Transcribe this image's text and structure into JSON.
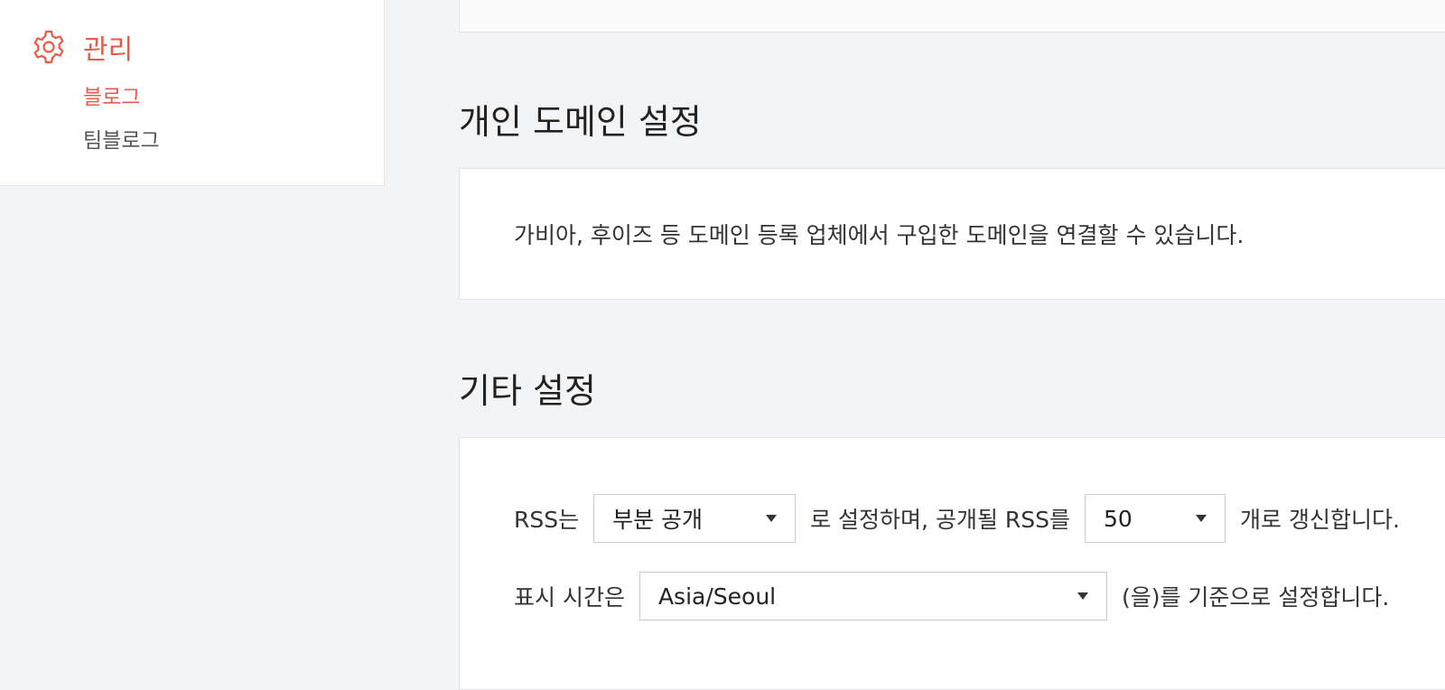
{
  "sidebar": {
    "title": "관리",
    "items": [
      {
        "label": "블로그",
        "active": true
      },
      {
        "label": "팀블로그",
        "active": false
      }
    ],
    "accent_color": "#eb5a46",
    "icon": "gear-icon"
  },
  "domain_section": {
    "title": "개인 도메인 설정",
    "description": "가비아, 후이즈 등 도메인 등록 업체에서 구입한 도메인을 연결할 수 있습니다."
  },
  "other_section": {
    "title": "기타 설정",
    "rss": {
      "prefix": "RSS는",
      "mode_value": "부분 공개",
      "middle": "로 설정하며, 공개될 RSS를",
      "count_value": "50",
      "suffix": "개로 갱신합니다."
    },
    "timezone": {
      "prefix": "표시 시간은",
      "value": "Asia/Seoul",
      "suffix": "(을)를 기준으로 설정합니다."
    }
  }
}
